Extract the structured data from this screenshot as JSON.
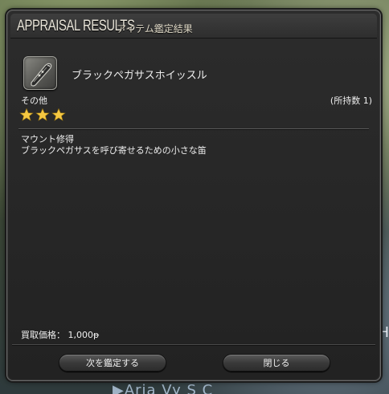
{
  "window": {
    "title_main": "APPRAISAL RESULTS",
    "title_sub": "アイテム鑑定結果"
  },
  "item": {
    "icon": "whistle-icon",
    "name": "ブラックペガサスホイッスル",
    "category": "その他",
    "owned": "(所持数 1)",
    "stars": 3,
    "star_color": "#f5c842",
    "effect_title": "マウント修得",
    "effect_description": "ブラックペガサスを呼び寄せるための小さな笛",
    "price": "買取価格： 1,000ᵽ"
  },
  "buttons": {
    "next": "次を鑑定する",
    "close": "閉じる"
  },
  "background": {
    "bottom_text": "▶Aria   Vy   S   C",
    "edge_text": "H"
  }
}
